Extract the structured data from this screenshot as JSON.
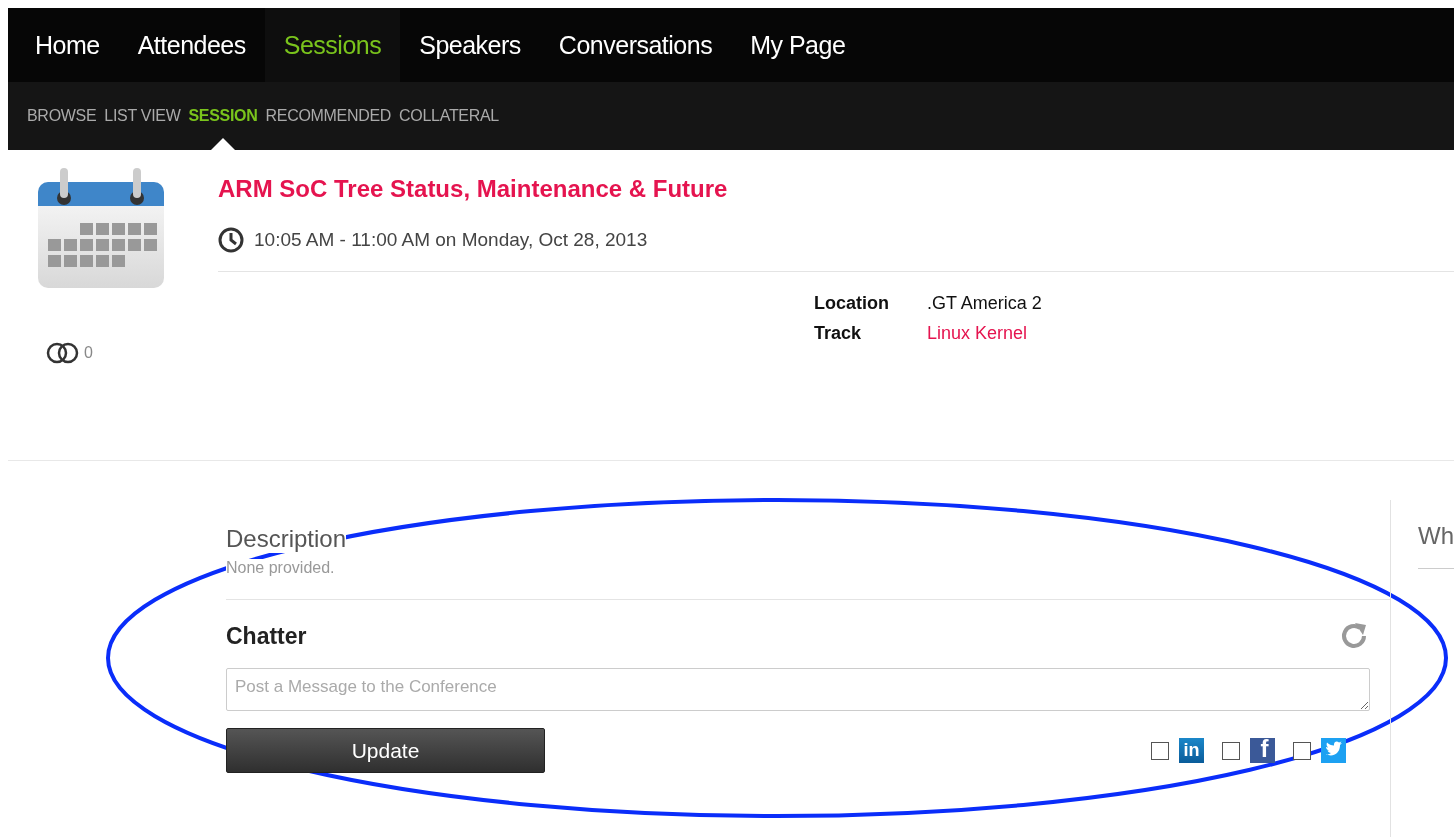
{
  "main_nav": [
    {
      "label": "Home",
      "selected": false
    },
    {
      "label": "Attendees",
      "selected": false
    },
    {
      "label": "Sessions",
      "selected": true
    },
    {
      "label": "Speakers",
      "selected": false
    },
    {
      "label": "Conversations",
      "selected": false
    },
    {
      "label": "My Page",
      "selected": false
    }
  ],
  "sub_nav": [
    {
      "label": "BROWSE",
      "selected": false
    },
    {
      "label": "LIST VIEW",
      "selected": false
    },
    {
      "label": "SESSION",
      "selected": true
    },
    {
      "label": "RECOMMENDED",
      "selected": false
    },
    {
      "label": "COLLATERAL",
      "selected": false
    }
  ],
  "session": {
    "title": "ARM SoC Tree Status, Maintenance & Future",
    "time": "10:05 AM - 11:00 AM on Monday, Oct 28, 2013",
    "attendee_count": "0",
    "details": [
      {
        "label": "Location",
        "value": "GT America 2",
        "kind": "text",
        "prefix": "."
      },
      {
        "label": "Track",
        "value": "Linux Kernel",
        "kind": "link"
      }
    ]
  },
  "description": {
    "heading": "Description",
    "text": "None provided."
  },
  "chatter": {
    "heading": "Chatter",
    "placeholder": "Post a Message to the Conference",
    "button": "Update",
    "share": [
      {
        "kind": "linkedin",
        "glyph": "in",
        "checked": false
      },
      {
        "kind": "facebook",
        "glyph": "f",
        "checked": false
      },
      {
        "kind": "twitter",
        "checked": false
      }
    ]
  },
  "side_panel": {
    "heading": "Wh"
  },
  "annotation": {
    "kind": "ellipse",
    "color": "#0a2dfa"
  }
}
